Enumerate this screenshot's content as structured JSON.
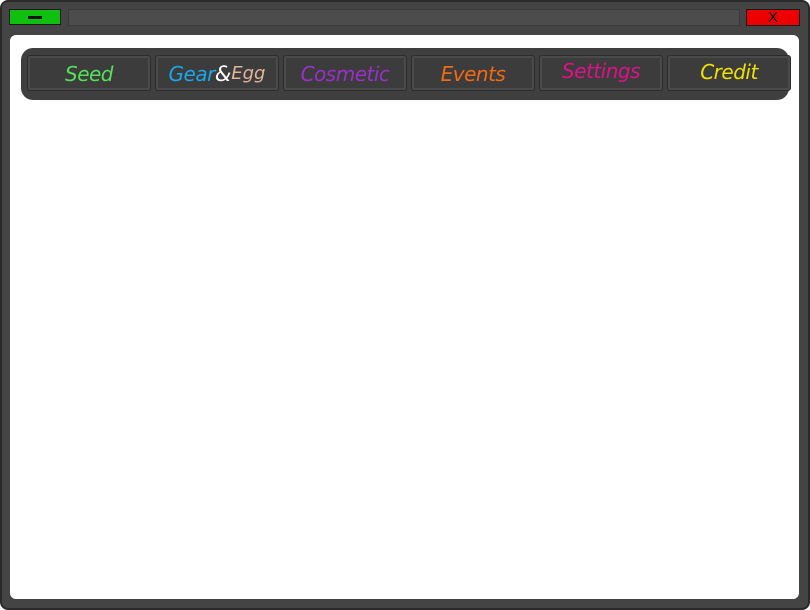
{
  "titlebar": {
    "minimize_label": "",
    "close_label": "X",
    "colors": {
      "minimize": "#10c010",
      "close": "#ee0000",
      "frame": "#444444"
    }
  },
  "tabs": [
    {
      "id": "seed",
      "label": "Seed",
      "color": "#55e05a"
    },
    {
      "id": "gear-egg",
      "label_gear": "Gear",
      "label_amp": "&",
      "label_egg": "Egg",
      "colors": {
        "gear": "#1aa6e8",
        "amp": "#ffffff",
        "egg": "#e2b49a"
      }
    },
    {
      "id": "cosmetic",
      "label": "Cosmetic",
      "color": "#9b30c8"
    },
    {
      "id": "events",
      "label": "Events",
      "color": "#f06a14"
    },
    {
      "id": "settings",
      "label": "Settings",
      "color": "#e0108a"
    },
    {
      "id": "credit",
      "label": "Credit",
      "color": "#f0e000"
    }
  ]
}
